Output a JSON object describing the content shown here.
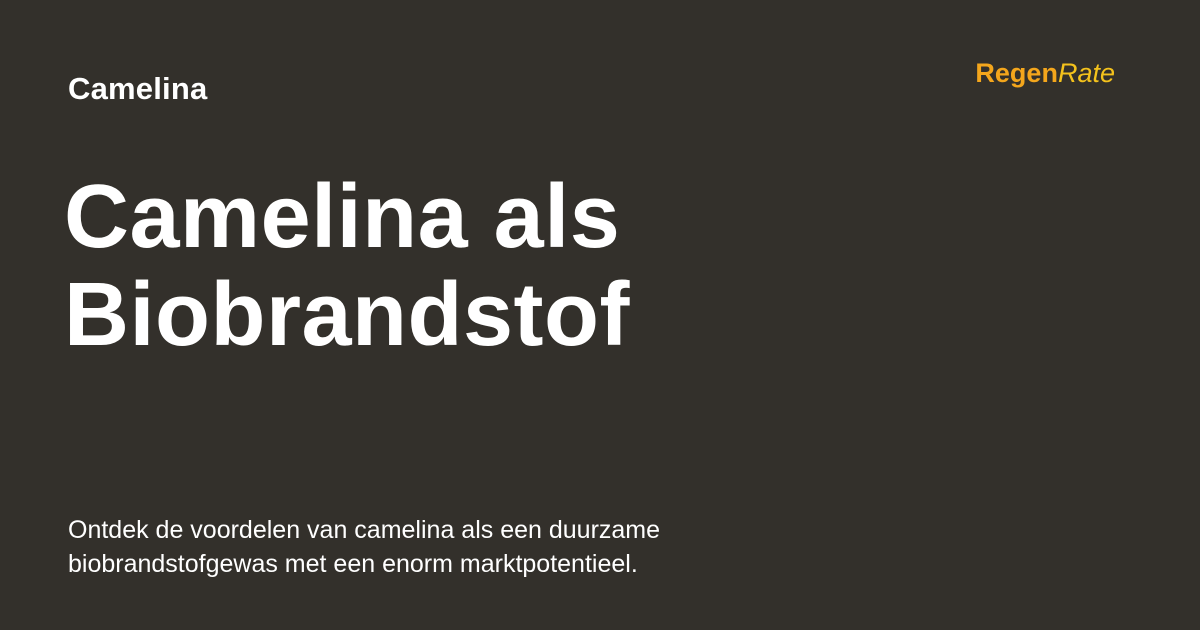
{
  "category": "Camelina",
  "brand": {
    "part1": "Regen",
    "part2": "Rate",
    "colors": {
      "part1": "#f4a61c",
      "part2": "#f4c21c"
    }
  },
  "title": {
    "lines": [
      "Camelina als",
      "Biobrandstof"
    ]
  },
  "description": {
    "lines": [
      "Ontdek de voordelen van camelina als een duurzame",
      "biobrandstofgewas met een enorm marktpotentieel."
    ]
  },
  "colors": {
    "background": "#33302b",
    "text": "#ffffff"
  }
}
